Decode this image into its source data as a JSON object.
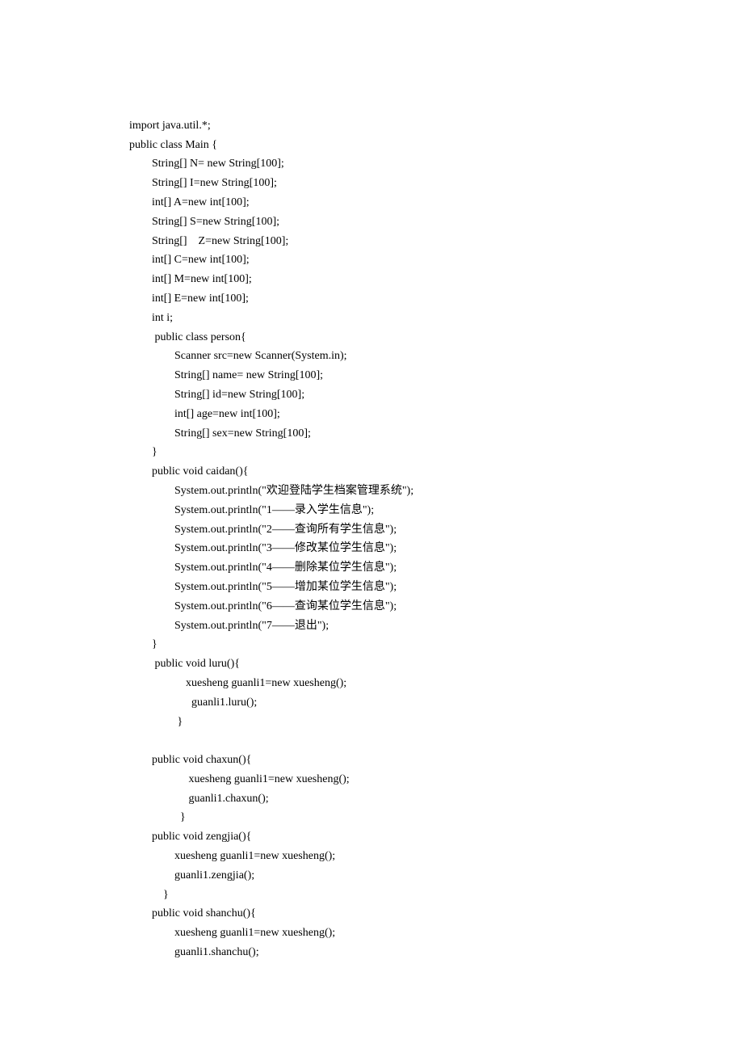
{
  "code": {
    "lines": [
      "import java.util.*;",
      "public class Main {",
      "        String[] N= new String[100];",
      "        String[] I=new String[100];",
      "        int[] A=new int[100];",
      "        String[] S=new String[100];",
      "        String[]    Z=new String[100];",
      "        int[] C=new int[100];",
      "        int[] M=new int[100];",
      "        int[] E=new int[100];",
      "        int i;",
      "         public class person{",
      "                Scanner src=new Scanner(System.in);",
      "                String[] name= new String[100];",
      "                String[] id=new String[100];",
      "                int[] age=new int[100];",
      "                String[] sex=new String[100];",
      "        }",
      "        public void caidan(){",
      "                System.out.println(\"欢迎登陆学生档案管理系统\");",
      "                System.out.println(\"1——录入学生信息\");",
      "                System.out.println(\"2——查询所有学生信息\");",
      "                System.out.println(\"3——修改某位学生信息\");",
      "                System.out.println(\"4——删除某位学生信息\");",
      "                System.out.println(\"5——增加某位学生信息\");",
      "                System.out.println(\"6——查询某位学生信息\");",
      "                System.out.println(\"7——退出\");",
      "        }",
      "         public void luru(){",
      "                    xuesheng guanli1=new xuesheng();",
      "                      guanli1.luru();",
      "                 }",
      "",
      "        public void chaxun(){",
      "                     xuesheng guanli1=new xuesheng();",
      "                     guanli1.chaxun();",
      "                  }",
      "        public void zengjia(){",
      "                xuesheng guanli1=new xuesheng();",
      "                guanli1.zengjia();",
      "            }",
      "        public void shanchu(){",
      "                xuesheng guanli1=new xuesheng();",
      "                guanli1.shanchu();"
    ]
  }
}
